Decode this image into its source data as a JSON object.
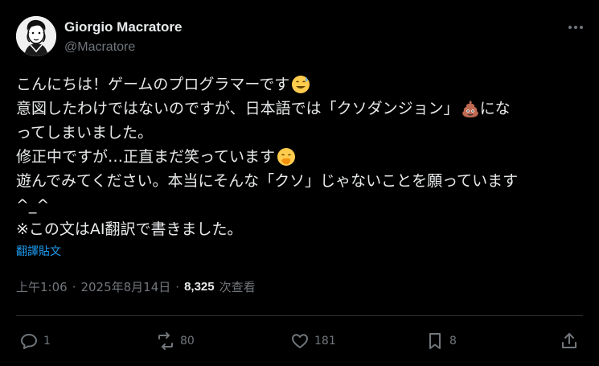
{
  "author": {
    "name": "Giorgio Macratore",
    "handle": "@Macratore"
  },
  "post": {
    "lines": [
      {
        "text": "こんにちは！ゲームのプログラマーです",
        "emoji": "sweat-smile-emoji"
      },
      {
        "text": "意図したわけではないのですが、日本語では「クソダンジョン」",
        "emoji": "poop-emoji",
        "tail": "にな"
      },
      {
        "text": "ってしまいました。"
      },
      {
        "text": "修正中ですが…正直まだ笑っています",
        "emoji": "hand-over-mouth-emoji"
      },
      {
        "text": "遊んでみてください。本当にそんな「クソ」じゃないことを願っています"
      },
      {
        "text": "^_^"
      },
      {
        "text": "※この文はAI翻訳で書きました。"
      }
    ],
    "translate_link": "翻譯貼文"
  },
  "meta": {
    "time": "上午1:06",
    "separator": "·",
    "date": "2025年8月14日",
    "views_count": "8,325",
    "views_label": "次查看"
  },
  "actions": {
    "reply_count": "1",
    "repost_count": "80",
    "like_count": "181",
    "bookmark_count": "8"
  },
  "icons": [
    "more-icon",
    "reply-icon",
    "repost-icon",
    "like-icon",
    "bookmark-icon",
    "share-icon"
  ],
  "colors": {
    "background": "#000000",
    "text": "#e7e9ea",
    "secondary": "#71767b",
    "link": "#1d9bf0"
  }
}
